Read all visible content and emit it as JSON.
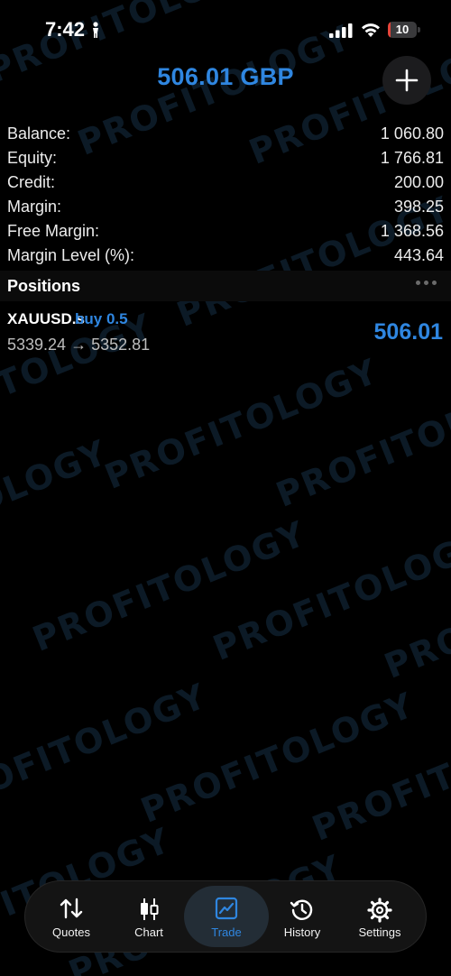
{
  "status_bar": {
    "time": "7:42",
    "battery": "10",
    "battery_fraction": 0.1
  },
  "header": {
    "title": "506.01 GBP"
  },
  "account_summary": [
    {
      "label": "Balance:",
      "value": "1 060.80"
    },
    {
      "label": "Equity:",
      "value": "1 766.81"
    },
    {
      "label": "Credit:",
      "value": "200.00"
    },
    {
      "label": "Margin:",
      "value": "398.25"
    },
    {
      "label": "Free Margin:",
      "value": "1 368.56"
    },
    {
      "label": "Margin Level (%):",
      "value": "443.64"
    }
  ],
  "positions": {
    "title": "Positions",
    "items": [
      {
        "symbol": "XAUUSD.s",
        "side": "buy 0.5",
        "open_price": "5339.24",
        "arrow": "→",
        "current_price": "5352.81",
        "profit": "506.01"
      }
    ]
  },
  "tab_bar": {
    "tabs": [
      {
        "label": "Quotes",
        "icon": "arrows-up-down-icon"
      },
      {
        "label": "Chart",
        "icon": "candlestick-icon"
      },
      {
        "label": "Trade",
        "icon": "trend-chart-icon",
        "active": true
      },
      {
        "label": "History",
        "icon": "history-clock-icon"
      },
      {
        "label": "Settings",
        "icon": "gear-icon"
      }
    ]
  },
  "watermark": {
    "text": "PROFITOLOGY"
  },
  "colors": {
    "accent": "#2f86e0",
    "background": "#000000",
    "battery_low": "#e5443a"
  }
}
